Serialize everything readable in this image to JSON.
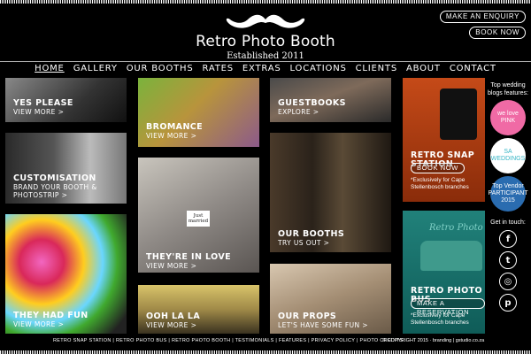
{
  "brand": {
    "title": "Retro Photo Booth",
    "established": "Established 2011"
  },
  "header_buttons": {
    "enquiry": "MAKE AN ENQUIRY",
    "book": "BOOK NOW"
  },
  "nav": [
    "HOME",
    "GALLERY",
    "OUR BOOTHS",
    "RATES",
    "EXTRAS",
    "LOCATIONS",
    "CLIENTS",
    "ABOUT",
    "CONTACT"
  ],
  "tiles": {
    "yes_please": {
      "title": "YES PLEASE",
      "link": "VIEW MORE >"
    },
    "customisation": {
      "title": "CUSTOMISATION",
      "line2": "BRAND YOUR BOOTH &",
      "line3": "PHOTOSTRIP >"
    },
    "they_had_fun": {
      "title": "THEY HAD FUN",
      "link": "VIEW MORE >"
    },
    "bromance": {
      "title": "BROMANCE",
      "link": "VIEW MORE >"
    },
    "theyre_in_love": {
      "title": "THEY'RE IN LOVE",
      "link": "VIEW MORE >",
      "sign": "Just married"
    },
    "ooh_la_la": {
      "title": "OOH LA LA",
      "link": "VIEW MORE >"
    },
    "guestbooks": {
      "title": "GUESTBOOKS",
      "link": "EXPLORE >"
    },
    "our_booths": {
      "title": "OUR BOOTHS",
      "link": "TRY US OUT >"
    },
    "our_props": {
      "title": "OUR PROPS",
      "link": "LET'S HAVE SOME FUN >"
    }
  },
  "snap_station": {
    "title": "RETRO SNAP STATION",
    "button": "BOOK NOW",
    "note": "*Exclusively for Cape Stellenbosch branches"
  },
  "photo_bus": {
    "title": "RETRO PHOTO BUS",
    "button": "MAKE A RESERVATION",
    "note": "*Exclusively for Cape Stellenbosch branches",
    "bus_text": "Retro Photo"
  },
  "sidebar": {
    "top_label": "Top wedding blogs features:",
    "badges": [
      {
        "name": "we love pink",
        "text": "we love PINK",
        "color": "#f06aa5"
      },
      {
        "name": "sa weddings",
        "text": "SA WEDDINGS",
        "color": "#39b6c6"
      },
      {
        "name": "top vendor",
        "text": "Top Vendor PARTICIPANT 2015",
        "color": "#2a6cb0"
      }
    ],
    "get_in_touch": "Get in touch:",
    "icons": [
      {
        "name": "facebook-icon",
        "glyph": "f"
      },
      {
        "name": "twitter-icon",
        "glyph": "t"
      },
      {
        "name": "instagram-icon",
        "glyph": "◎"
      },
      {
        "name": "pinterest-icon",
        "glyph": "p"
      }
    ]
  },
  "footer": {
    "links": "RETRO SNAP STATION | RETRO PHOTO BUS | RETRO PHOTO BOOTH | TESTIMONIALS | FEATURES | PRIVACY POLICY | PHOTO CREDITS",
    "copyright": "© COPYRIGHT 2015 · branding | gstudio.co.za"
  }
}
